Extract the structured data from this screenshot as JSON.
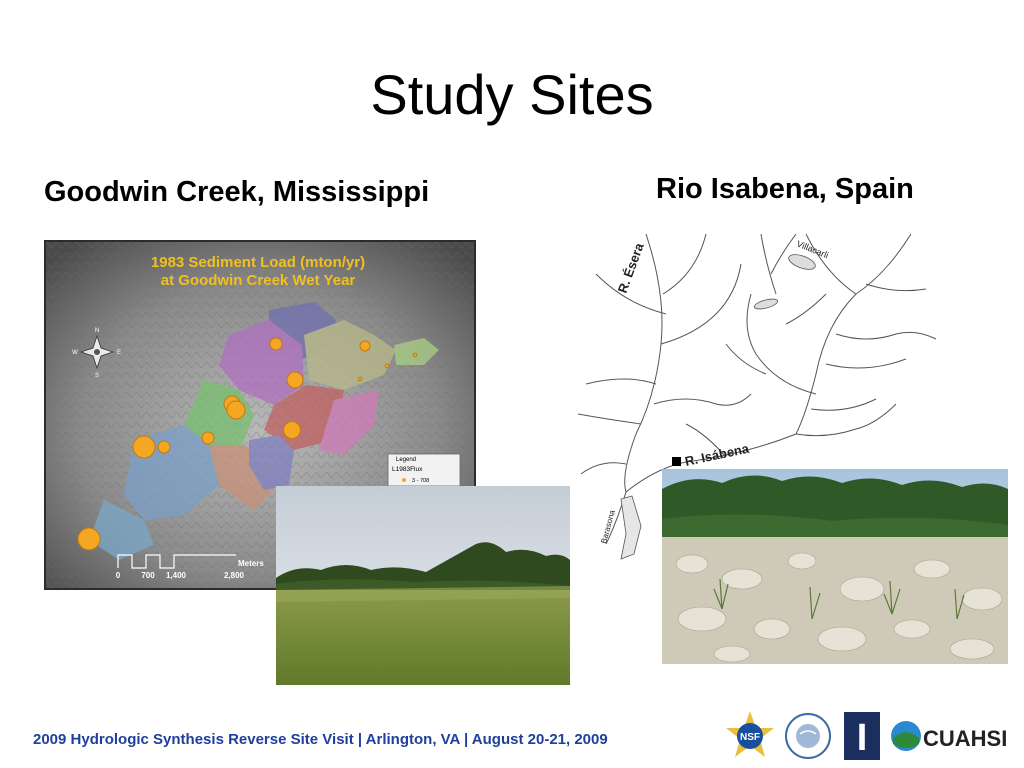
{
  "slide": {
    "title": "Study Sites",
    "left_heading": "Goodwin Creek, Mississippi",
    "right_heading": "Rio Isabena, Spain"
  },
  "left_map": {
    "title_line1": "1983 Sediment Load (mton/yr)",
    "title_line2": "at Goodwin Creek Wet Year",
    "compass": {
      "n": "N",
      "s": "S",
      "e": "E",
      "w": "W"
    },
    "scale": {
      "unit": "Meters",
      "ticks": [
        "0",
        "700",
        "1,400",
        "2,800"
      ]
    },
    "legend": {
      "title": "Legend",
      "layer": "L1983Flux",
      "entry": "3 - 708"
    }
  },
  "right_map": {
    "labels": {
      "esera": "R. Ésera",
      "isabena": "R. Isábena",
      "villacarli": "Villacarli",
      "barasona": "Barasona"
    }
  },
  "footer": {
    "text": "2009 Hydrologic Synthesis Reverse Site Visit | Arlington, VA | August 20-21, 2009",
    "logos": {
      "nsf": "NSF",
      "university": "I",
      "cuahsi": "CUAHSI"
    }
  },
  "colors": {
    "footer_text": "#1f3f9e",
    "map_title": "#f0c020",
    "site_marker": "#f5a623"
  }
}
